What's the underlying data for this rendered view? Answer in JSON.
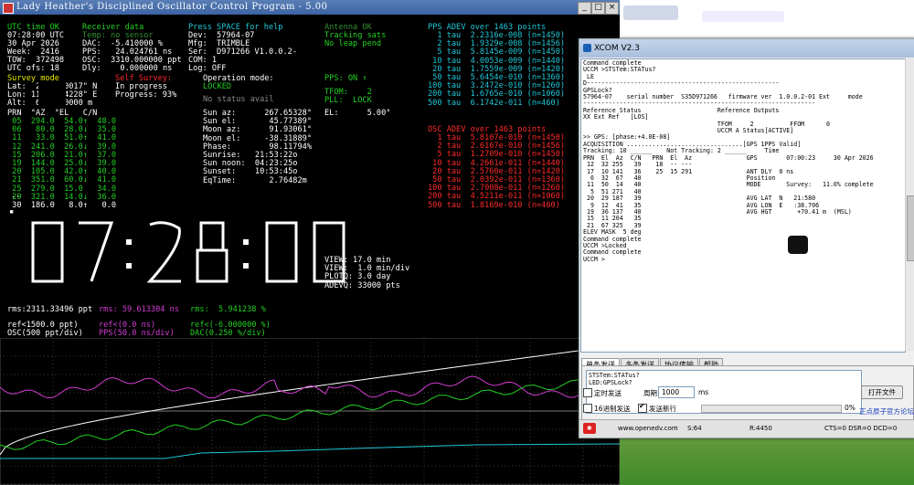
{
  "colors": {
    "bg": "#000000",
    "green": "#22d022",
    "white": "#ffffff",
    "yellow": "#e8e800",
    "cyan": "#1ec8d8",
    "magenta": "#d43cd4",
    "red": "#ff2a2a"
  },
  "lh": {
    "title": "Lady Heather's Disciplined Oscillator Control Program - 5.00",
    "utc_header": "UTC time OK",
    "time_row": "07:28:00 UTC",
    "date_row": "30 Apr 2026",
    "week_row": "Week:  2416",
    "tow_row": "TOW:  372498",
    "utc_ofs_row": "UTC ofs: 18",
    "rcv_header": "Receiver data",
    "rcv_temp": "Temp: no sensor",
    "rcv_dac": "DAC:  -5.410000 %",
    "rcv_pps": "PPS:   24.024761 ns",
    "rcv_osc": "OSC:  3310.000000 ppt",
    "rcv_dly": "Dly:    0.000000 ns",
    "help": "Press SPACE for help",
    "dev": "Dev:  57964-07",
    "mfg": "Mfg:  TRIMBLE",
    "ser": "Ser:  D971266 V1.0.0.2-",
    "com": "COM: 1",
    "log": "Log: OFF",
    "ant": "Antenna OK",
    "tracking": "Tracking sats",
    "leap": "No leap pend",
    "pps_adev_title": "PPS ADEV over 1463 points",
    "pps_adev": [
      "  1 tau  2.2316e-008 (n=1450)",
      "  2 tau  1.9329e-008 (n=1456)",
      "  5 tau  5.8145e-009 (n=1450)",
      " 10 tau  4.0053e-009 (n=1440)",
      " 20 tau  1.7559e-009 (n=1420)",
      " 50 tau  5.6454e-010 (n=1360)",
      "100 tau  3.2472e-010 (n=1260)",
      "200 tau  1.6765e-010 (n=1060)",
      "500 tau  6.1742e-011 (n=460)"
    ],
    "osc_adev_title": "OSC ADEV over 1463 points",
    "osc_adev": [
      "  1 tau  5.8107e-010 (n=1450)",
      "  2 tau  2.6167e-010 (n=1456)",
      "  5 tau  1.2709e-010 (n=1450)",
      " 10 tau  4.2661e-011 (n=1440)",
      " 20 tau  2.5760e-011 (n=1420)",
      " 50 tau  2.0392e-011 (n=1360)",
      "100 tau  2.7008e-011 (n=1260)",
      "200 tau  4.5211e-011 (n=1060)",
      "500 tau  1.8169e-010 (n=460)"
    ],
    "survey_mode": "Survey mode",
    "lat": "Lat:  22 1560017\" N",
    "lon": "Lon: 11 '4 74228\" E",
    "alt": "Alt:  6 79000000 m",
    "self_survey": "Self Survey:",
    "in_progress": "In progress",
    "progress": "Progress: 93%",
    "op_mode_title": "Operation mode:",
    "op_locked": "LOCKED",
    "no_status": "No status avail",
    "pps_on": "PPS: ON ↑",
    "tfom": "TFOM:    2",
    "pll": "PLL:  LOCK",
    "el": "EL:      5.00°",
    "sat_header": "PRN  °AZ  °EL   C/N",
    "sats": [
      " 05  294.0  54.0↑  48.0",
      " 06   80.0  28.0↓  35.0",
      " 11   33.0  51.0↑  41.0",
      " 12  241.0  26.0↓  39.0",
      " 15  206.0  21.0↑  37.0",
      " 19  144.0  25.0↓  39.0",
      " 20  105.0  42.0↑  40.0",
      " 21  351.0  60.0↓  41.0",
      " 25  279.0  15.0   34.0",
      " 29  321.0  14.0↓  36.0",
      " 30  186.0   8.0↑   0.0"
    ],
    "sun_az": "Sun az:      267.65328°",
    "sun_el": "Sun el:       45.77389°",
    "moon_az": "Moon az:      91.93061°",
    "moon_el": "Moon el:     -38.31889°",
    "phase": "Phase:        98.11794%",
    "sunrise": "Sunrise:   21:53:22o",
    "sunnoon": "Sun noon:  04:23:25o",
    "sunset": "Sunset:    10:53:45o",
    "eqtime": "EqTime:       2.76482m",
    "clock": [
      "0",
      "7",
      ":",
      "2",
      "8",
      ":",
      "0",
      "0"
    ],
    "view1": "VIEW: 17.0 min",
    "view2": "VIEW:  1.0 min/div",
    "plotq": "PLOTQ: 3.0 day",
    "adevq": "ADEVQ: 33000 pts",
    "rms_osc": "rms:2311.33496 ppt",
    "rms_pps": "rms: 59.613304 ns",
    "rms_dac": "rms:  5.941238 %",
    "ref_osc": "ref<1500.0 ppt)",
    "ref_pps": "ref<(0.0 ns)",
    "ref_dac": "ref<(-6.000000 %)",
    "leg_osc": "OSC(500 ppt/div)",
    "leg_pps": "PPS(50.0 ns/div)",
    "leg_dac": "DAC(0.250 %/div)",
    "dots": "..",
    "tick": "▪"
  },
  "xcom": {
    "title": "XCOM V2.3",
    "lines_a": [
      "Command complete",
      "UCCM >STSTem:STATus?",
      " LE",
      "D-----------------------------------------------------",
      "GPSLock?",
      "57964-07    serial number  S35D971266   firmware ver  1.0.0.2-01 Ext     mode",
      "----------------------------------------------------------------",
      "Reference Status                     Reference Outputs",
      "XX Ext Ref   [LOS]",
      "",
      "                                     TFOM     2          FFOM      0",
      "                                     UCCM A Status[ACTIVE]",
      "",
      ">> GPS: [phase:+4.0E-08]",
      "ACQUISITION ................................[GPS 1PPS Valid]",
      "Tracking: 10 ______    Not Tracking: 2 ______     Time",
      "PRN  El  Az  C/N   PRN  El  Az               GPS        07:00:23     30 Apr 2026",
      " 12  32 255   39    18  -- ---",
      " 17  10 141   36    25  15 291               ANT DLY  0 ns",
      "  6  32  67   40                             Position",
      " 11  50  14   40                             MODE       Survey:   11.0% complete",
      "  5  51 271   40",
      " 20  29 187   39                             AVG LAT  N   21:580",
      "  9  12  41   35                             AVG LON  E   :38.706",
      " 19  36 137   40                             AVG HGT       +70.41 m  (MSL)",
      " 15  11 204   35",
      " 21  67 325   39",
      "",
      "",
      "ELEV MASK  5 deg",
      "",
      "Command complete",
      "UCCM >Locked",
      "Command complete",
      "UCCM >"
    ],
    "tabs": [
      "单条发送",
      "多条发送",
      "协议传输",
      "帮助"
    ],
    "send_text": [
      "STSTem:STATus?",
      "LED:GPSLock?"
    ],
    "timed_send": "定时发送",
    "period_label": "周期:",
    "period_value": "1000",
    "period_unit": "ms",
    "open_file": "打开文件",
    "hex_send": "16进制发送",
    "newline_send": "发送新行",
    "percent": "0%",
    "brand": "正点原子官方论坛",
    "url": "www.openedv.com",
    "s_count": "S:64",
    "r_count": "R:4450",
    "cts": "CTS=0 DSR=0 DCD=0"
  }
}
